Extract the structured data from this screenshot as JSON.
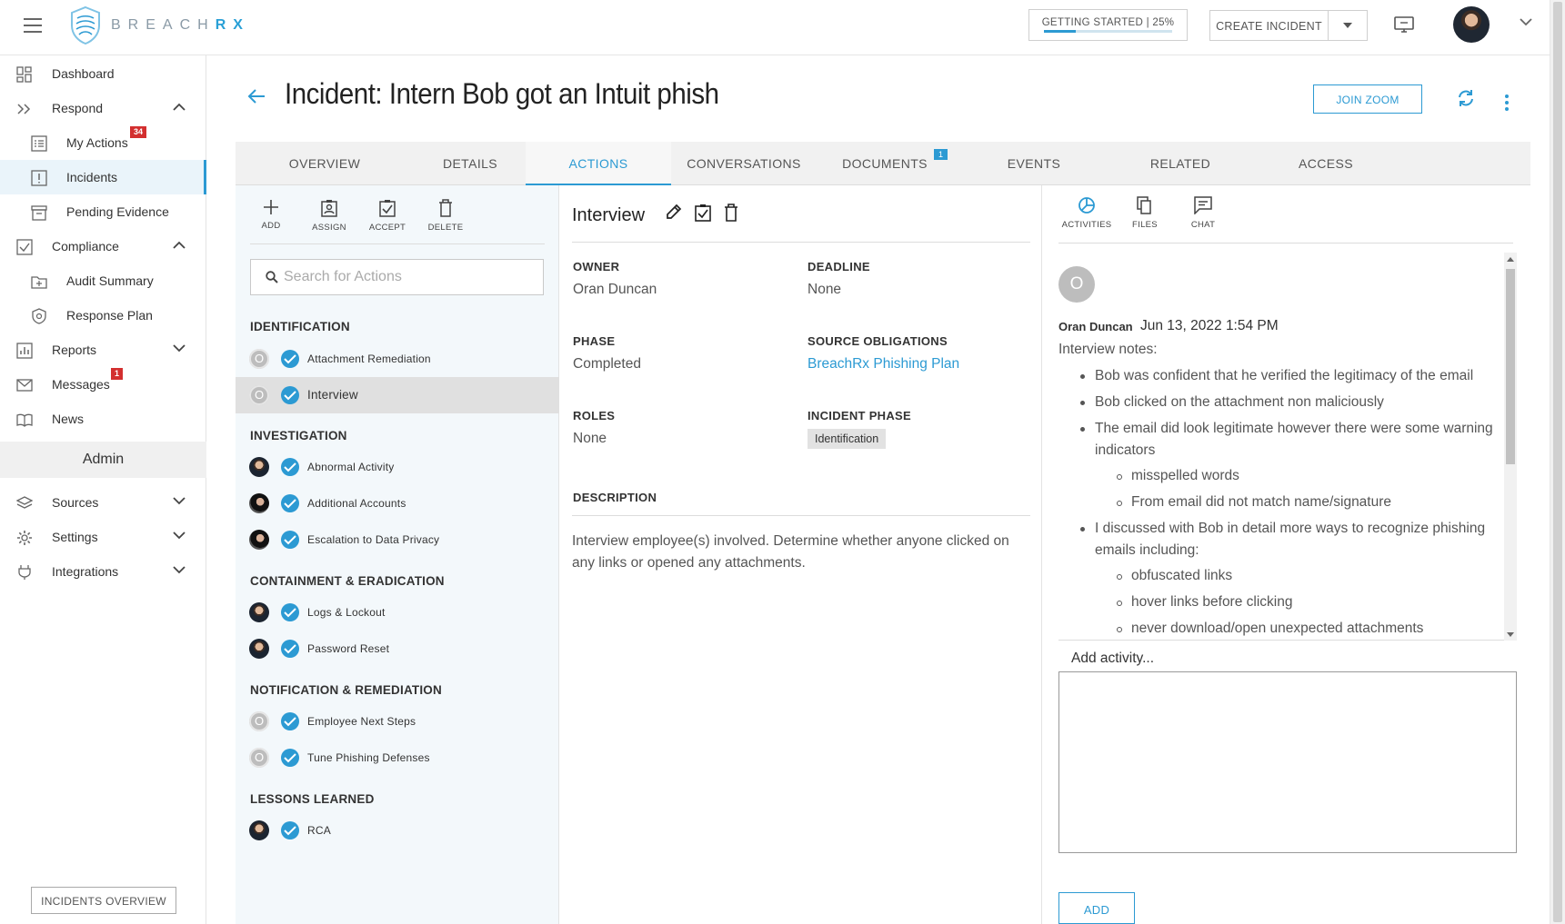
{
  "brand": {
    "name_light": "BREACH",
    "name_bold": "RX",
    "accent": "#2c9ad3"
  },
  "topbar": {
    "getting_started": "GETTING STARTED | 25%",
    "getting_started_progress": 0.25,
    "create_incident": "CREATE INCIDENT"
  },
  "sidebar": {
    "items": [
      {
        "label": "Dashboard",
        "icon": "dashboard-icon"
      },
      {
        "label": "Respond",
        "icon": "double-chevron-icon"
      },
      {
        "label": "My Actions",
        "icon": "list-icon",
        "badge": "34"
      },
      {
        "label": "Incidents",
        "icon": "incident-icon"
      },
      {
        "label": "Pending Evidence",
        "icon": "archive-icon"
      },
      {
        "label": "Compliance",
        "icon": "checkbox-icon"
      },
      {
        "label": "Audit Summary",
        "icon": "folder-icon"
      },
      {
        "label": "Response Plan",
        "icon": "shield-icon"
      },
      {
        "label": "Reports",
        "icon": "bar-chart-icon"
      },
      {
        "label": "Messages",
        "icon": "mail-icon",
        "badge": "1"
      },
      {
        "label": "News",
        "icon": "book-icon"
      },
      {
        "label": "Sources",
        "icon": "layers-icon"
      },
      {
        "label": "Settings",
        "icon": "gear-icon"
      },
      {
        "label": "Integrations",
        "icon": "plug-icon"
      }
    ],
    "admin": "Admin",
    "incidents_overview": "INCIDENTS OVERVIEW"
  },
  "header": {
    "title": "Incident: Intern Bob got an Intuit phish",
    "join_zoom": "JOIN ZOOM"
  },
  "tabs": [
    {
      "label": "OVERVIEW"
    },
    {
      "label": "DETAILS"
    },
    {
      "label": "ACTIONS"
    },
    {
      "label": "CONVERSATIONS"
    },
    {
      "label": "DOCUMENTS",
      "badge": "1"
    },
    {
      "label": "EVENTS"
    },
    {
      "label": "RELATED"
    },
    {
      "label": "ACCESS"
    }
  ],
  "actions_panel": {
    "toolbar": {
      "add": "ADD",
      "assign": "ASSIGN",
      "accept": "ACCEPT",
      "delete": "DELETE"
    },
    "search_placeholder": "Search for Actions",
    "phases": [
      {
        "name": "IDENTIFICATION",
        "actions": [
          {
            "name": "Attachment Remediation",
            "avatar": "O"
          },
          {
            "name": "Interview",
            "avatar": "O"
          }
        ]
      },
      {
        "name": "INVESTIGATION",
        "actions": [
          {
            "name": "Abnormal Activity"
          },
          {
            "name": "Additional Accounts"
          },
          {
            "name": "Escalation to Data Privacy"
          }
        ]
      },
      {
        "name": "CONTAINMENT & ERADICATION",
        "actions": [
          {
            "name": "Logs & Lockout"
          },
          {
            "name": "Password Reset"
          }
        ]
      },
      {
        "name": "NOTIFICATION & REMEDIATION",
        "actions": [
          {
            "name": "Employee Next Steps",
            "avatar": "O"
          },
          {
            "name": "Tune Phishing Defenses",
            "avatar": "O"
          }
        ]
      },
      {
        "name": "LESSONS LEARNED",
        "actions": [
          {
            "name": "RCA"
          }
        ]
      }
    ]
  },
  "detail": {
    "title": "Interview",
    "owner_label": "OWNER",
    "owner": "Oran Duncan",
    "deadline_label": "DEADLINE",
    "deadline": "None",
    "phase_label": "PHASE",
    "phase": "Completed",
    "source_label": "SOURCE OBLIGATIONS",
    "source": "BreachRx Phishing Plan",
    "roles_label": "ROLES",
    "roles": "None",
    "incident_phase_label": "INCIDENT PHASE",
    "incident_phase": "Identification",
    "description_label": "DESCRIPTION",
    "description": "Interview employee(s) involved. Determine whether anyone clicked on any links or opened any attachments."
  },
  "activity": {
    "toolbar": {
      "activities": "ACTIVITIES",
      "files": "FILES",
      "chat": "CHAT"
    },
    "avatar": "O",
    "author": "Oran Duncan",
    "date": "Jun 13, 2022 1:54 PM",
    "intro": "Interview notes:",
    "notes": [
      "Bob was confident that he verified the legitimacy of the email",
      "Bob clicked on the attachment non maliciously",
      "The email did look legitimate however there were some warning indicators",
      "misspelled words",
      "From email did not match name/signature",
      "I discussed with Bob in detail more ways to recognize phishing emails including:",
      "obfuscated links",
      "hover links before clicking",
      "never download/open unexpected attachments"
    ],
    "add_label": "Add activity...",
    "add_button": "ADD"
  }
}
